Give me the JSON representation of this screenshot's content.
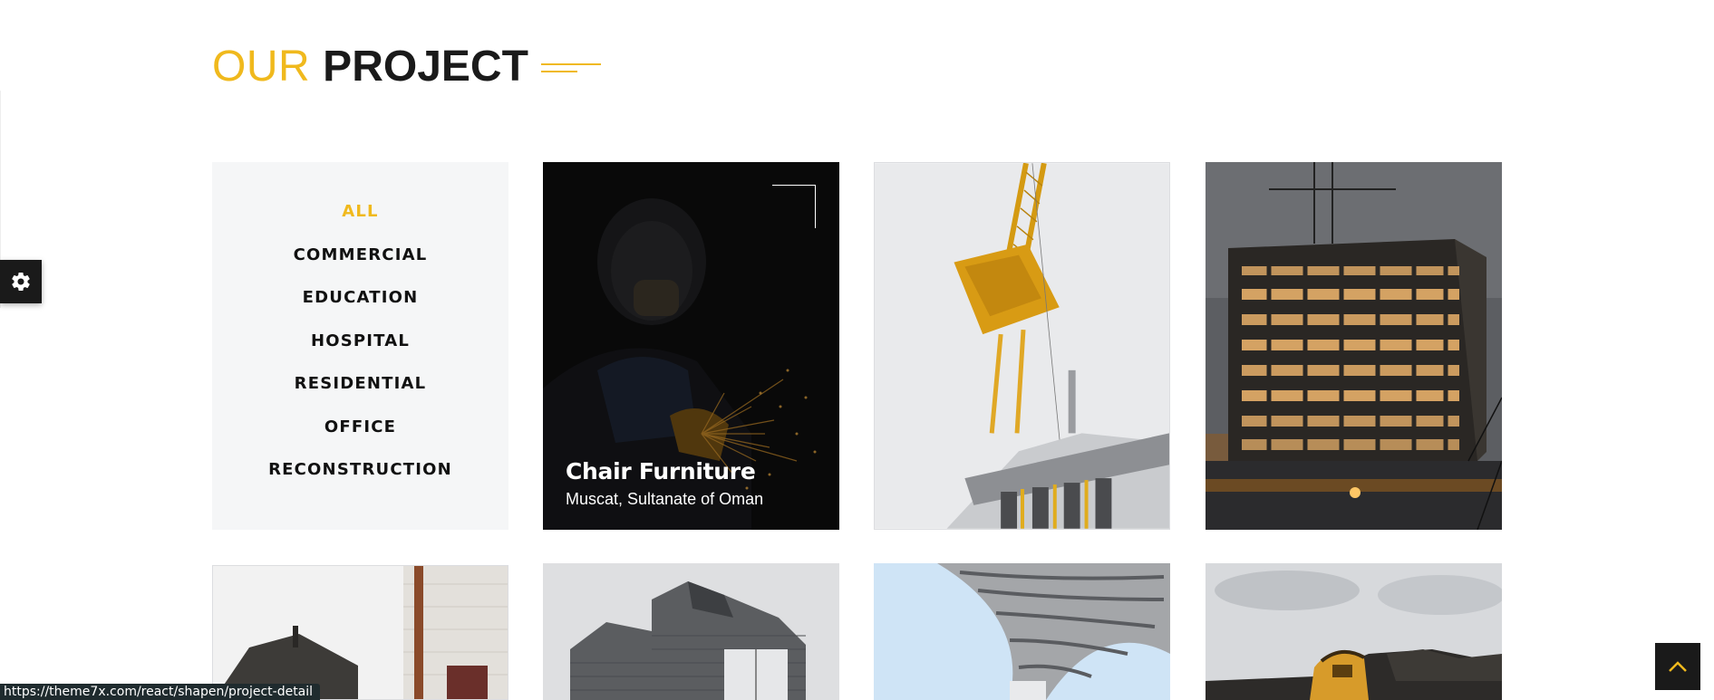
{
  "section": {
    "title_light": "OUR",
    "title_bold": "PROJECT"
  },
  "filters": [
    {
      "label": "ALL",
      "active": true
    },
    {
      "label": "COMMERCIAL",
      "active": false
    },
    {
      "label": "EDUCATION",
      "active": false
    },
    {
      "label": "HOSPITAL",
      "active": false
    },
    {
      "label": "RESIDENTIAL",
      "active": false
    },
    {
      "label": "OFFICE",
      "active": false
    },
    {
      "label": "RECONSTRUCTION",
      "active": false
    }
  ],
  "projects": [
    {
      "image": "welder-sparks",
      "title": "Chair Furniture",
      "location": "Muscat, Sultanate of Oman",
      "hovered": true
    },
    {
      "image": "tower-crane"
    },
    {
      "image": "building-under-construction-night"
    },
    {
      "image": "white-building-with-pipe"
    },
    {
      "image": "grey-brick-house"
    },
    {
      "image": "curved-tower-from-below"
    },
    {
      "image": "yellow-excavator"
    }
  ],
  "status_bar": {
    "url": "https://theme7x.com/react/shapen/project-detail"
  },
  "colors": {
    "accent": "#f0b91d",
    "dark": "#1a1a1a",
    "filter_bg": "#f5f6f7"
  },
  "icons": {
    "settings": "gear-icon",
    "back_to_top": "chevron-up-icon"
  }
}
